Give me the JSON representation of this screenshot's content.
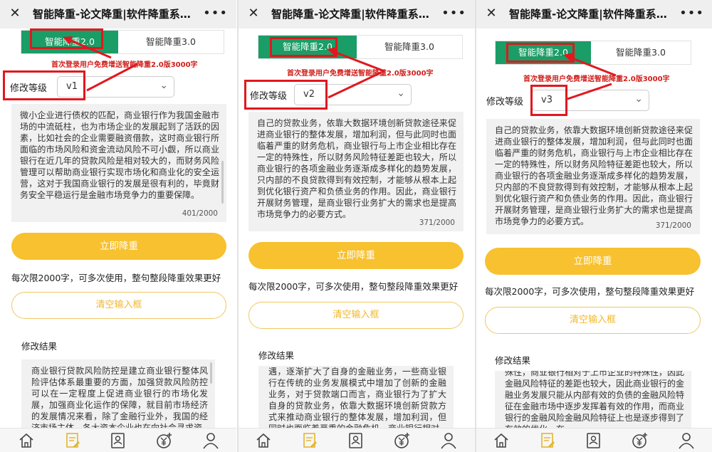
{
  "window": {
    "title": "智能降重-论文降重|软件降重系统|A...",
    "close_glyph": "✕",
    "more_glyph": "•••"
  },
  "tabs": {
    "active": "智能降重2.0",
    "inactive": "智能降重3.0"
  },
  "promo": "首次登录用户免费增送智能降重2.0版3000字",
  "level_label": "修改等级",
  "submit_label": "立即降重",
  "limit_note": "每次限2000字，可多次使用，整句整段降重效果更好",
  "clear_label": "清空输入框",
  "result_title": "修改结果",
  "panels": [
    {
      "level": "v1",
      "input_text": "微小企业进行债权的匹配，商业银行作为我国金融市场的中流砥柱，也为市场企业的发展起到了活跃的因素，比如社会的企业需要融资借款，这时商业银行所面临的市场风险和资金流动风险不可小觑，所以商业银行在近几年的贷款风险是相对较大的，而财务风险管理可以帮助商业银行实现市场化和商业化的安全运营，这对于我国商业银行的发展是很有利的，毕竟财务安全平稳运行是金融市场竞争力的重要保障。",
      "count": "401/2000",
      "result_text": "商业银行贷款风险防控是建立商业银行整体风险评估体系最重要的方面，加强贷款风险防控可以在一定程度上促进商业银行的市场化发展，加强商业化运作的保障，就目前市场经济的发展情况来看，除了金融行业外，我国的经济市场主体，各大资本企业也在向社会寻求资"
    },
    {
      "level": "v2",
      "input_text": "自己的贷款业务，依靠大数据环境创新贷款途径来促进商业银行的整体发展，增加利润，但与此同时也面临着严重的财务危机，商业银行与上市企业相比存在一定的特殊性，所以财务风险特征差距也较大，所以商业银行的各项金融业务逐渐成多样化的趋势发展，只内部的不良贷款得到有效控制，才能够从根本上起到优化银行资产和负债业务的作用。因此，商业银行开展财务管理，是商业银行业务扩大的需求也是提高市场竞争力的必要方式。",
      "count": "371/2000",
      "result_text": "遇，逐渐扩大了自身的金融业务，一些商业银行在传统的业务发展模式中增加了创新的金融业务，对于贷款端口而言，商业银行为了扩大自身的贷款业务，依靠大数据环境创新贷款方式来推动商业银行的整体发展，增加利润，但同时也面临着严重的金融危机，商业银行相对"
    },
    {
      "level": "v3",
      "input_text": "自己的贷款业务，依靠大数据环境创新贷款途径来促进商业银行的整体发展，增加利润，但与此同时也面临着严重的财务危机，商业银行与上市企业相比存在一定的特殊性，所以财务风险特征差距也较大，所以商业银行的各项金融业务逐渐成多样化的趋势发展，只内部的不良贷款得到有效控制，才能够从根本上起到优化银行资产和负债业务的作用。因此，商业银行开展财务管理，是商业银行业务扩大的需求也是提高市场竞争力的必要方式。",
      "count": "371/2000",
      "result_text": "殊性，商业银行相对于上市企业的特殊性，因此金融风险特征的差距也较大，因此商业银行的金融业务发展只能从内部有效的负债的金融风险特征在金融市场中逐步发挥着有效的作用，而商业银行的金融风险金融风险特征上也是逐步得到了有效的优化，在"
    }
  ],
  "colors": {
    "green": "#1a9d66",
    "yellow": "#f7c12f",
    "red": "#e0181e"
  },
  "nav_icons": [
    "home-icon",
    "document-edit-icon",
    "profile-card-icon",
    "yuan-plus-icon",
    "user-icon"
  ]
}
